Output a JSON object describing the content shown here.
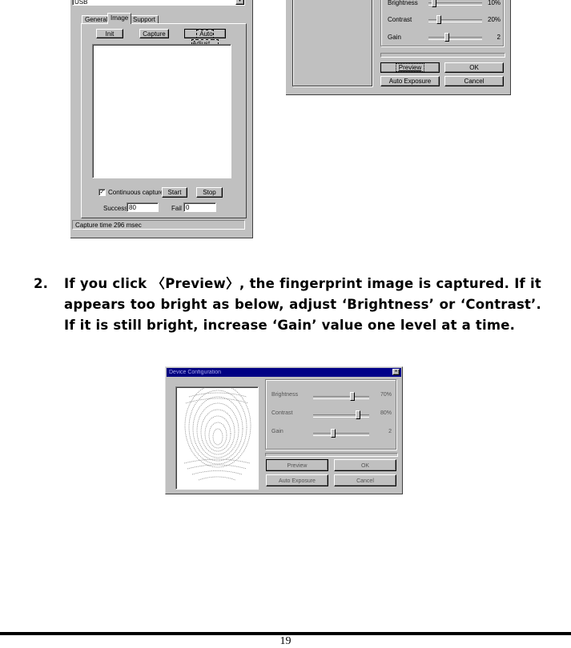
{
  "dialog_top_left": {
    "device_select_value": "USB",
    "tabs": [
      {
        "label": "General",
        "active": false
      },
      {
        "label": "Image",
        "active": true
      },
      {
        "label": "Support",
        "active": false
      }
    ],
    "buttons": {
      "init": "Init",
      "capture": "Capture",
      "auto_adjust": "Auto Adjust..."
    },
    "continuous_capture": {
      "label": "Continuous capture",
      "checked": true
    },
    "start_label": "Start",
    "stop_label": "Stop",
    "success_label": "Success",
    "success_value": "80",
    "fail_label": "Fail",
    "fail_value": "0",
    "status_text": "Capture time 296 msec"
  },
  "dialog_top_right": {
    "sliders": [
      {
        "label": "Brightness",
        "value_text": "10%",
        "fraction": 0.1
      },
      {
        "label": "Contrast",
        "value_text": "20%",
        "fraction": 0.2
      },
      {
        "label": "Gain",
        "value_text": "2",
        "fraction": 0.35
      }
    ],
    "buttons": {
      "preview": "Preview",
      "ok": "OK",
      "auto_exposure": "Auto Exposure",
      "cancel": "Cancel"
    }
  },
  "instruction": {
    "number": "2.",
    "text": "If you click 〈Preview〉, the fingerprint image is captured. If it appears too bright as below, adjust ‘Brightness’ or ‘Contrast’. If it is still bright, increase ‘Gain’ value one level at a time."
  },
  "dialog_bottom": {
    "title": "Device Configuration",
    "close_icon": "close-icon",
    "sliders": [
      {
        "label": "Brightness",
        "value_text": "70%",
        "fraction": 0.7
      },
      {
        "label": "Contrast",
        "value_text": "80%",
        "fraction": 0.8
      },
      {
        "label": "Gain",
        "value_text": "2",
        "fraction": 0.35
      }
    ],
    "buttons": {
      "preview": "Preview",
      "ok": "OK",
      "auto_exposure": "Auto Exposure",
      "cancel": "Cancel"
    },
    "title_bar_color": "#000080"
  },
  "footer": {
    "page_number": "19"
  }
}
